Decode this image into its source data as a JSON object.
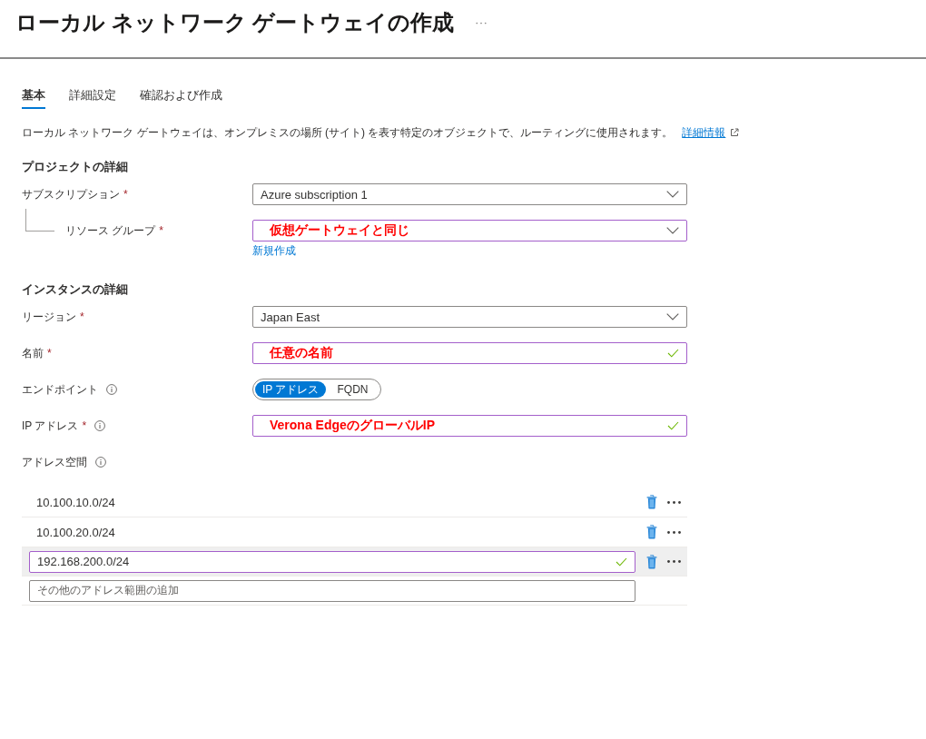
{
  "header": {
    "title": "ローカル ネットワーク ゲートウェイの作成"
  },
  "tabs": [
    {
      "label": "基本",
      "selected": true
    },
    {
      "label": "詳細設定",
      "selected": false
    },
    {
      "label": "確認および作成",
      "selected": false
    }
  ],
  "description": {
    "text": "ローカル ネットワーク ゲートウェイは、オンプレミスの場所 (サイト) を表す特定のオブジェクトで、ルーティングに使用されます。",
    "link": "詳細情報"
  },
  "sections": [
    {
      "heading": "プロジェクトの詳細",
      "fields": [
        {
          "kind": "dropdown",
          "label": "サブスクリプション",
          "required_mark": "*",
          "value": "Azure subscription 1",
          "highlighted": false,
          "annotation": false,
          "children": [
            {
              "kind": "dropdown",
              "label": "リソース グループ",
              "required_mark": "*",
              "value": "仮想ゲートウェイと同じ",
              "highlighted": true,
              "annotation": true,
              "link": "新規作成"
            }
          ]
        }
      ]
    },
    {
      "heading": "インスタンスの詳細",
      "fields": [
        {
          "kind": "dropdown",
          "label": "リージョン",
          "required_mark": "*",
          "value": "Japan East",
          "highlighted": false,
          "annotation": false
        },
        {
          "kind": "text",
          "label": "名前",
          "required_mark": "*",
          "value": "任意の名前",
          "highlighted": true,
          "annotation": true,
          "valid": true
        },
        {
          "kind": "toggle",
          "label": "エンドポイント",
          "info": true,
          "options": [
            {
              "label": "IP アドレス",
              "selected": true
            },
            {
              "label": "FQDN",
              "selected": false
            }
          ]
        },
        {
          "kind": "text",
          "label": "IP アドレス",
          "required_mark": "*",
          "info": true,
          "value": "Verona EdgeのグローバルIP",
          "highlighted": true,
          "annotation": true,
          "valid": true
        },
        {
          "kind": "list",
          "label": "アドレス空間",
          "info": true,
          "items": [
            {
              "kind": "entry",
              "value": "10.100.10.0/24",
              "selected": false
            },
            {
              "kind": "entry",
              "value": "10.100.20.0/24",
              "selected": false
            },
            {
              "kind": "input",
              "value": "192.168.200.0/24",
              "selected": true,
              "highlighted": true,
              "annotation": false,
              "valid": true
            },
            {
              "kind": "new",
              "placeholder": "その他のアドレス範囲の追加",
              "selected": false
            }
          ]
        }
      ]
    }
  ]
}
